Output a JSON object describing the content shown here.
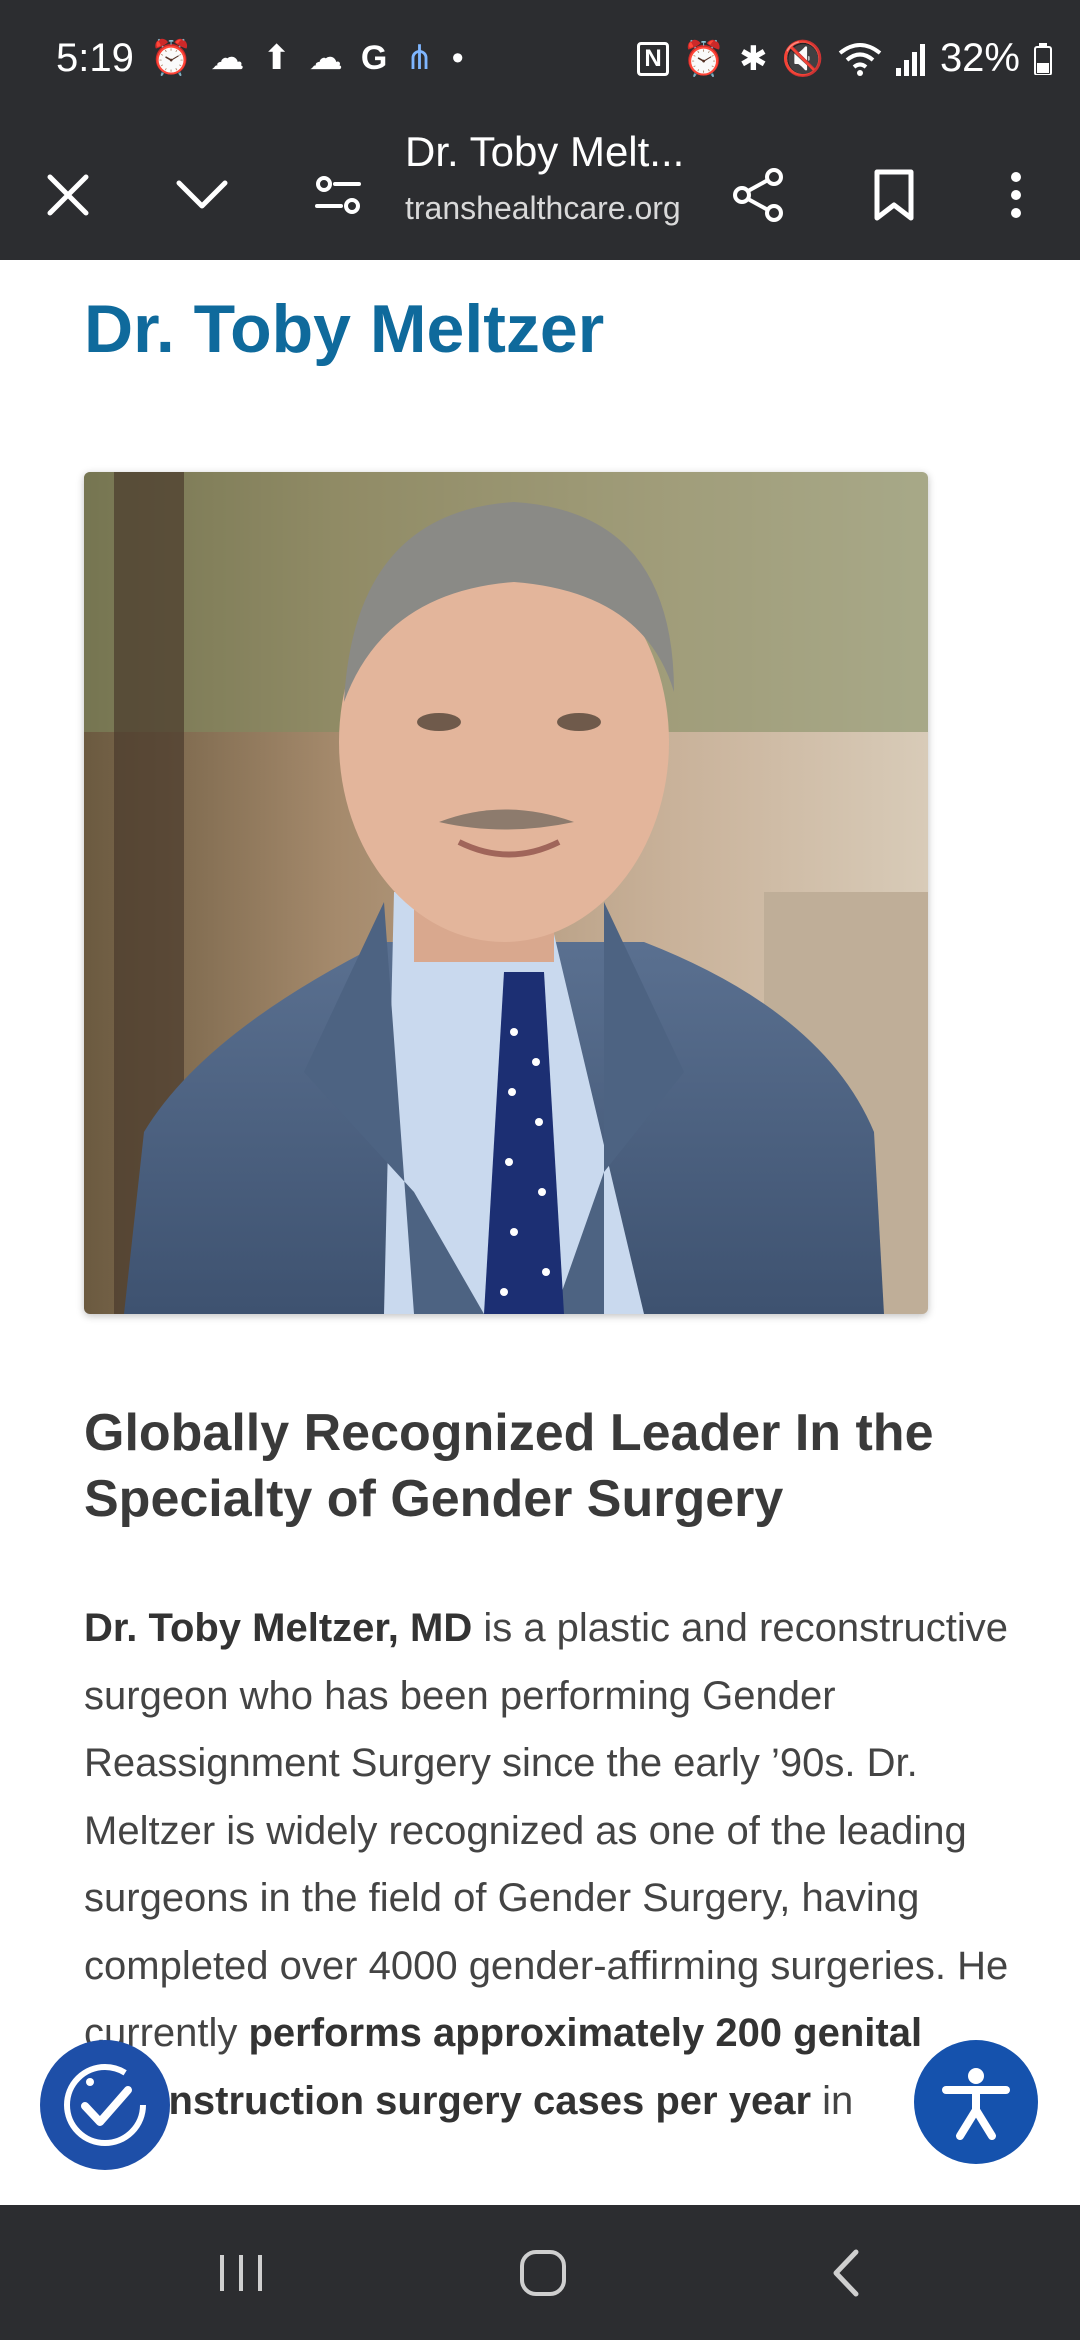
{
  "status_bar": {
    "time": "5:19",
    "battery": "32%"
  },
  "browser": {
    "page_title": "Dr. Toby Melt...",
    "domain": "transhealthcare.org"
  },
  "page": {
    "heading": "Dr. Toby Meltzer",
    "photo_alt": "Portrait of Dr. Toby Meltzer",
    "subheading": "Globally Recognized Leader In the Specialty of Gender Surgery",
    "para_bold_1": "Dr. Toby Meltzer, MD",
    "para_text_1": " is a plastic and reconstructive surgeon who has been performing Gender Reassignment Surgery since the early ’90s. Dr. Meltzer is widely recognized as one of the leading surgeons in the field of Gender Surgery, having completed over 4000 gender-affirming surgeries. He currently ",
    "para_bold_2": "performs approximately 200 genital reconstruction surgery cases per year",
    "para_text_2": " in"
  },
  "colors": {
    "heading_blue": "#0f6a9c",
    "fab_blue": "#1552ad",
    "chrome_bg": "#2c2d30"
  }
}
